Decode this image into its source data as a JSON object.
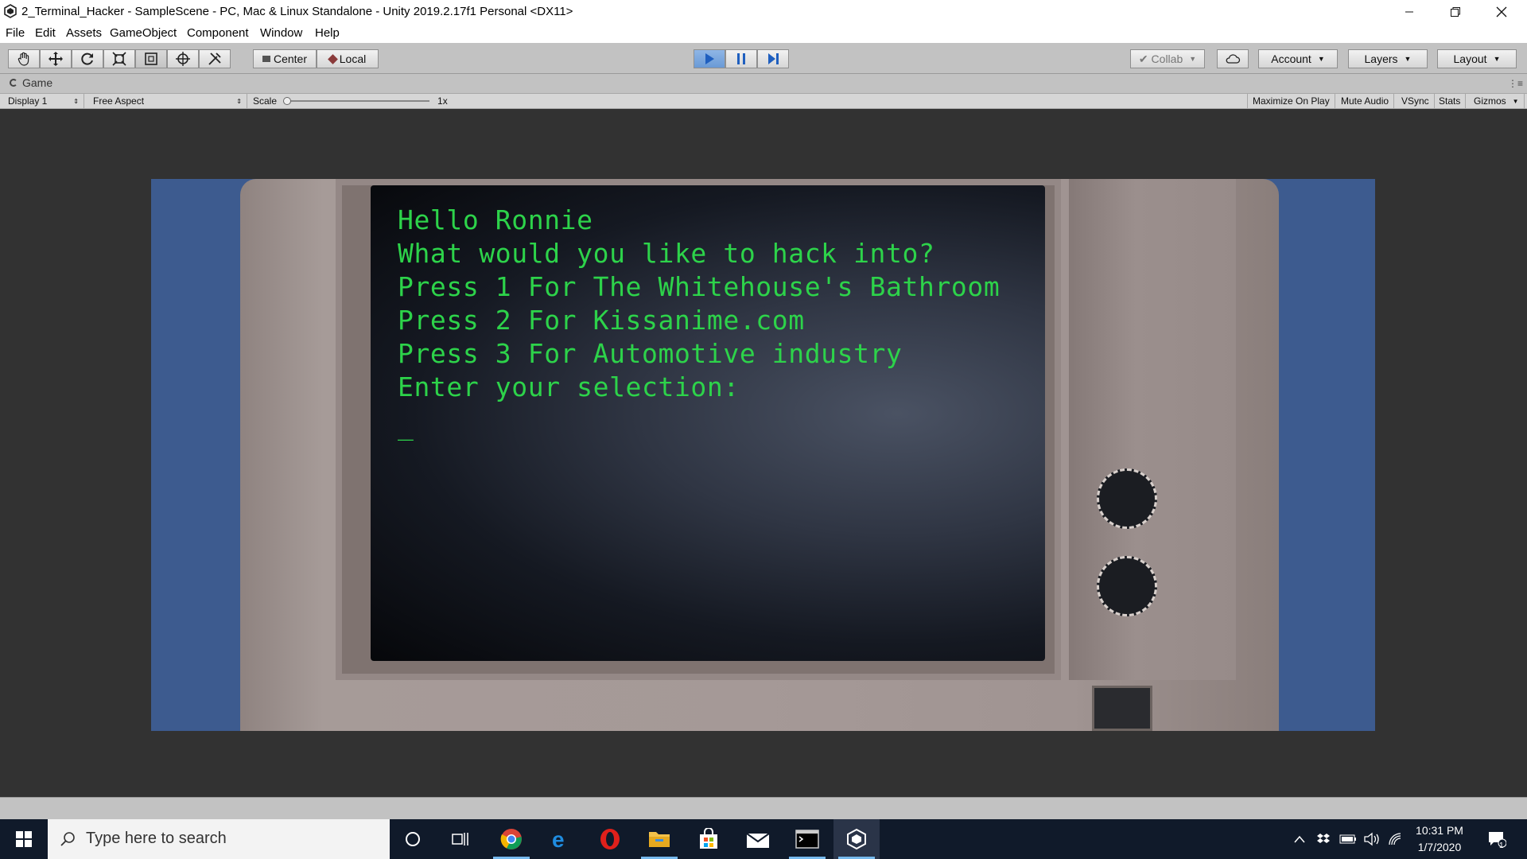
{
  "window": {
    "title": "2_Terminal_Hacker - SampleScene - PC, Mac & Linux Standalone - Unity 2019.2.17f1 Personal <DX11>",
    "minimize_icon": "minimize-icon",
    "restore_icon": "restore-icon",
    "close_icon": "close-icon"
  },
  "menu": [
    "File",
    "Edit",
    "Assets",
    "GameObject",
    "Component",
    "Window",
    "Help"
  ],
  "toolbar": {
    "tools": [
      "hand-tool-icon",
      "move-tool-icon",
      "rotate-tool-icon",
      "scale-tool-icon",
      "rect-tool-icon",
      "transform-tool-icon",
      "custom-tool-icon"
    ],
    "pivot_label": "Center",
    "space_label": "Local",
    "collab_label": "Collab",
    "account_label": "Account",
    "layers_label": "Layers",
    "layout_label": "Layout",
    "play_active": true
  },
  "game_tab": {
    "label": "Game"
  },
  "game_bar": {
    "display": "Display 1",
    "aspect": "Free Aspect",
    "scale_label": "Scale",
    "scale_value": "1x",
    "maximize": "Maximize On Play",
    "mute": "Mute Audio",
    "vsync": "VSync",
    "stats": "Stats",
    "gizmos": "Gizmos"
  },
  "terminal": {
    "lines": [
      "Hello Ronnie",
      "What would you like to hack into?",
      "Press 1 For The Whitehouse's Bathroom",
      "Press 2 For Kissanime.com",
      "Press 3 For Automotive industry",
      "Enter your selection:"
    ],
    "cursor": "_",
    "text_color": "#2dd34a"
  },
  "taskbar": {
    "search_placeholder": "Type here to search",
    "apps": [
      "cortana-icon",
      "task-view-icon",
      "chrome-icon",
      "edge-icon",
      "opera-icon",
      "file-explorer-icon",
      "store-icon",
      "mail-icon",
      "terminal-icon",
      "unity-icon"
    ],
    "time": "10:31 PM",
    "date": "1/7/2020",
    "notification_count": "1"
  },
  "colors": {
    "scene_background": "#3d5b8f",
    "taskbar": "#101a2a",
    "editor_gray": "#c2c2c2"
  }
}
